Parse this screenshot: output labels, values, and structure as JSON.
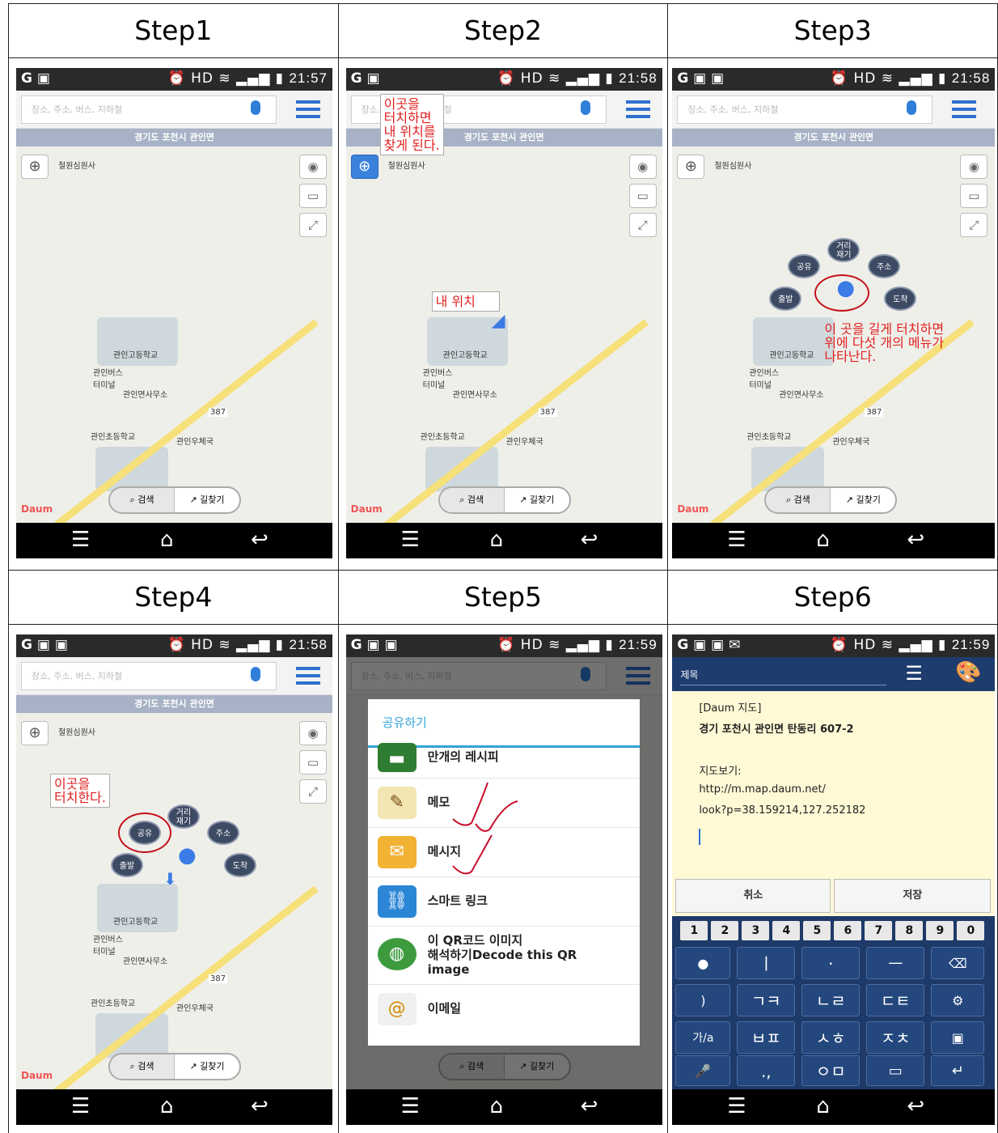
{
  "steps": [
    "Step1",
    "Step2",
    "Step3",
    "Step4",
    "Step5",
    "Step6"
  ],
  "times": [
    "21:57",
    "21:58",
    "21:58",
    "21:58",
    "21:59",
    "21:59"
  ],
  "search_placeholder": "장소, 주소, 버스, 지하철",
  "region": "경기도 포천시 관인면",
  "map_labels": {
    "temple": "철원심원사",
    "high_school": "관인고등학교",
    "bus_terminal": "관인버스\n터미널",
    "office": "관인면사무소",
    "elementary": "관인초등학교",
    "post_office": "관인우체국",
    "route": "387",
    "brand": "Daum"
  },
  "bottom_toggle": {
    "search": "검색",
    "directions": "길찾기"
  },
  "step2": {
    "callout": "이곳을\n터치하면\n내 위치를\n찾게 된다.",
    "my_location": "내 위치"
  },
  "radial_menu": {
    "distance": "거리\n재기",
    "share": "공유",
    "address": "주소",
    "start": "출발",
    "arrive": "도착"
  },
  "step3_note": "이 곳을 길게 터치하면\n위에 다섯 개의 메뉴가\n나타난다.",
  "step4_note": "이곳을\n터치한다.",
  "share_dialog": {
    "title": "공유하기",
    "items": [
      "만개의 레시피",
      "메모",
      "메시지",
      "스마트 링크",
      "이 QR코드 이미지\n해석하기Decode this QR\nimage",
      "이메일"
    ]
  },
  "memo": {
    "title_placeholder": "제목",
    "lines": [
      "[Daum 지도]",
      "경기 포천시 관인면 탄동리 607-2",
      "",
      "지도보기:",
      "http://m.map.daum.net/",
      "look?p=38.159214,127.252182"
    ],
    "cancel": "취소",
    "save": "저장"
  },
  "keyboard": {
    "numbers": [
      "1",
      "2",
      "3",
      "4",
      "5",
      "6",
      "7",
      "8",
      "9",
      "0"
    ],
    "rows": [
      [
        "●",
        "ㅣ",
        "·",
        "ㅡ",
        "⌫"
      ],
      [
        ")",
        "ㄱㅋ",
        "ㄴㄹ",
        "ㄷㅌ",
        "⚙"
      ],
      [
        "가/a",
        "ㅂㅍ",
        "ㅅㅎ",
        "ㅈㅊ",
        "▣"
      ],
      [
        "🎤",
        ".,",
        "ㅇㅁ",
        "▭",
        "↵"
      ]
    ]
  },
  "colors": {
    "annotation": "#e02020",
    "accent": "#2f6fcf",
    "region_bar": "#a7b2c6",
    "keyboard": "#1e3a69"
  }
}
